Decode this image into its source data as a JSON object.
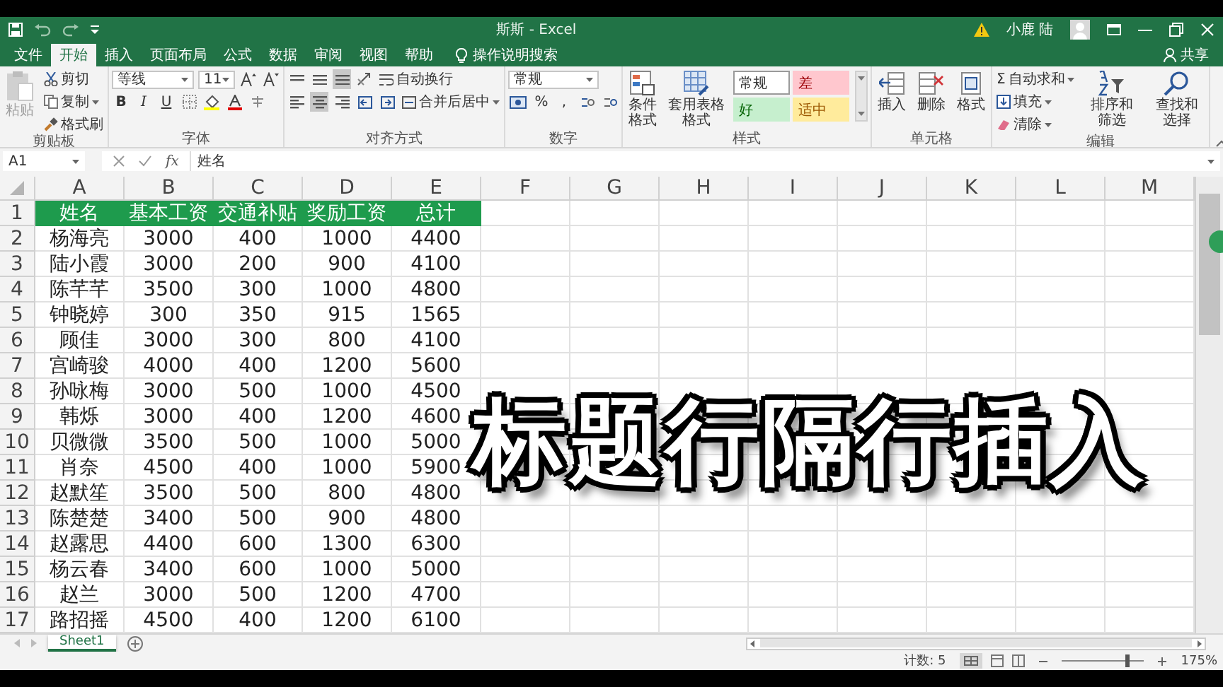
{
  "window": {
    "title": "斯斯 - Excel",
    "user": "小鹿 陆"
  },
  "tabs": [
    {
      "label": "文件",
      "selected": false
    },
    {
      "label": "开始",
      "selected": true
    },
    {
      "label": "插入",
      "selected": false
    },
    {
      "label": "页面布局",
      "selected": false
    },
    {
      "label": "公式",
      "selected": false
    },
    {
      "label": "数据",
      "selected": false
    },
    {
      "label": "审阅",
      "selected": false
    },
    {
      "label": "视图",
      "selected": false
    },
    {
      "label": "帮助",
      "selected": false
    }
  ],
  "tell_me": "操作说明搜索",
  "share": "共享",
  "ribbon": {
    "clipboard": {
      "label": "剪贴板",
      "paste": {
        "label": "粘贴",
        "disabled": true
      },
      "cut": "剪切",
      "copy": "复制",
      "format_painter": "格式刷"
    },
    "font": {
      "label": "字体",
      "font_name": "等线",
      "font_size": "11",
      "bold": "B",
      "italic": "I",
      "underline": "U"
    },
    "alignment": {
      "label": "对齐方式",
      "vertical": [
        {
          "selected": false
        },
        {
          "selected": false
        },
        {
          "selected": true
        }
      ],
      "horizontal": [
        {
          "selected": false
        },
        {
          "selected": true
        },
        {
          "selected": false
        }
      ],
      "wrap_text": "自动换行",
      "merge_center": "合并后居中"
    },
    "number": {
      "label": "数字",
      "format": "常规",
      "percent": "%",
      "comma": ","
    },
    "styles": {
      "label": "样式",
      "conditional": "条件格式",
      "table_format": "套用表格格式",
      "cell_styles": [
        {
          "label": "常规",
          "color": "#ffffff",
          "selected": true
        },
        {
          "label": "差",
          "color": "#ffc7ce",
          "selected": false
        },
        {
          "label": "好",
          "color": "#c6efce",
          "selected": false
        },
        {
          "label": "适中",
          "color": "#ffeb9c",
          "selected": false
        }
      ]
    },
    "cells": {
      "label": "单元格",
      "insert": "插入",
      "delete": "删除",
      "format": "格式"
    },
    "editing": {
      "label": "编辑",
      "autosum_symbol": "Σ",
      "autosum": "自动求和",
      "fill": "填充",
      "clear": "清除",
      "sort_filter": "排序和筛选",
      "find_select": "查找和选择"
    }
  },
  "formula_bar": {
    "name_box": "A1",
    "fx": "fx",
    "value": "姓名"
  },
  "sheet": {
    "columns": [
      "A",
      "B",
      "C",
      "D",
      "E",
      "F",
      "G",
      "H",
      "I",
      "J",
      "K",
      "L",
      "M"
    ],
    "rows": [
      {
        "number": "1",
        "highlighted": true,
        "cells": [
          "姓名",
          "基本工资",
          "交通补贴",
          "奖励工资",
          "总计"
        ]
      },
      {
        "number": "2",
        "highlighted": false,
        "cells": [
          "杨海亮",
          "3000",
          "400",
          "1000",
          "4400"
        ]
      },
      {
        "number": "3",
        "highlighted": false,
        "cells": [
          "陆小霞",
          "3000",
          "200",
          "900",
          "4100"
        ]
      },
      {
        "number": "4",
        "highlighted": false,
        "cells": [
          "陈芊芊",
          "3500",
          "300",
          "1000",
          "4800"
        ]
      },
      {
        "number": "5",
        "highlighted": false,
        "cells": [
          "钟晓婷",
          "300",
          "350",
          "915",
          "1565"
        ]
      },
      {
        "number": "6",
        "highlighted": false,
        "cells": [
          "顾佳",
          "3000",
          "300",
          "800",
          "4100"
        ]
      },
      {
        "number": "7",
        "highlighted": false,
        "cells": [
          "宫崎骏",
          "4000",
          "400",
          "1200",
          "5600"
        ]
      },
      {
        "number": "8",
        "highlighted": false,
        "cells": [
          "孙咏梅",
          "3000",
          "500",
          "1000",
          "4500"
        ]
      },
      {
        "number": "9",
        "highlighted": false,
        "cells": [
          "韩烁",
          "3000",
          "400",
          "1200",
          "4600"
        ]
      },
      {
        "number": "10",
        "highlighted": false,
        "cells": [
          "贝微微",
          "3500",
          "500",
          "1000",
          "5000"
        ]
      },
      {
        "number": "11",
        "highlighted": false,
        "cells": [
          "肖奈",
          "4500",
          "400",
          "1000",
          "5900"
        ]
      },
      {
        "number": "12",
        "highlighted": false,
        "cells": [
          "赵默笙",
          "3500",
          "500",
          "800",
          "4800"
        ]
      },
      {
        "number": "13",
        "highlighted": false,
        "cells": [
          "陈楚楚",
          "3400",
          "500",
          "900",
          "4800"
        ]
      },
      {
        "number": "14",
        "highlighted": false,
        "cells": [
          "赵露思",
          "4400",
          "600",
          "1300",
          "6300"
        ]
      },
      {
        "number": "15",
        "highlighted": false,
        "cells": [
          "杨云春",
          "3400",
          "600",
          "1000",
          "5000"
        ]
      },
      {
        "number": "16",
        "highlighted": false,
        "cells": [
          "赵兰",
          "3000",
          "500",
          "1200",
          "4700"
        ]
      },
      {
        "number": "17",
        "highlighted": false,
        "cells": [
          "路招摇",
          "4500",
          "400",
          "1200",
          "6100"
        ]
      }
    ]
  },
  "caption": "标题行隔行插入",
  "sheet_tabs": [
    {
      "label": "Sheet1",
      "selected": true
    }
  ],
  "status_bar": {
    "count": "计数: 5",
    "zoom": "175%",
    "zoom_slider": {
      "level": 0.78
    }
  }
}
